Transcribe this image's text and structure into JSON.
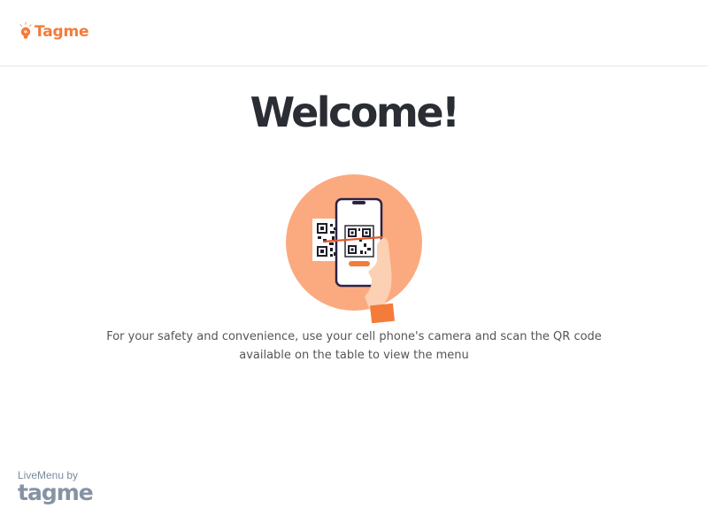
{
  "header": {
    "brand_name": "Tagme",
    "brand_icon": "lightbulb-icon",
    "brand_color": "#f47b3a"
  },
  "main": {
    "title": "Welcome!",
    "illustration": "qr-scan-illustration",
    "description_line1": "For your safety and convenience, use your cell phone's camera and scan the QR code",
    "description_line2": "available on the table to view the menu"
  },
  "footer": {
    "powered_by": "LiveMenu by",
    "brand_name": "tagme"
  }
}
